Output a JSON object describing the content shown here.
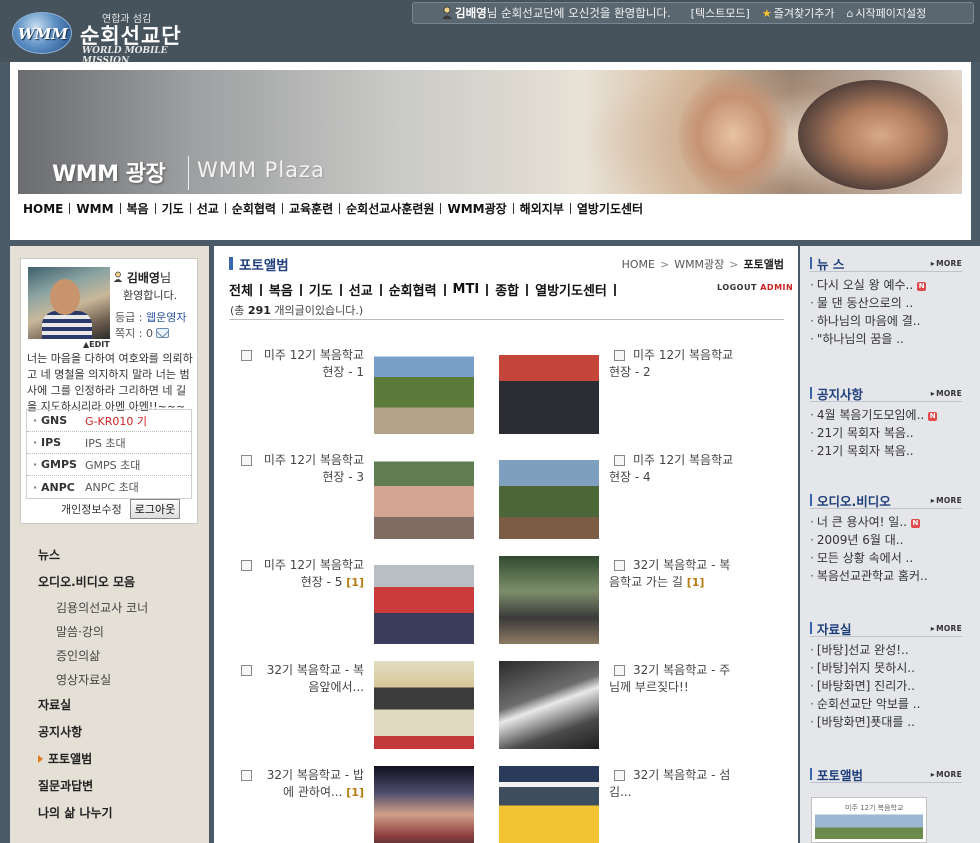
{
  "brand": {
    "tagline": "연합과 섬김",
    "name_kr": "순회선교단",
    "name_en": "WORLD MOBILE MISSION",
    "logo_text": "WMM"
  },
  "welcome": {
    "user": "김배영",
    "message": "님 순회선교단에 오신것을 환영합니다.",
    "text_mode": "[텍스트모드]",
    "bookmark": "즐겨찾기추가",
    "homepage": "시작페이지설정"
  },
  "banner": {
    "title": "WMM 광장",
    "subtitle": "WMM  Plaza"
  },
  "main_nav": [
    {
      "label": "HOME"
    },
    {
      "label": "WMM"
    },
    {
      "label": "복음"
    },
    {
      "label": "기도"
    },
    {
      "label": "선교"
    },
    {
      "label": "순회협력"
    },
    {
      "label": "교육훈련"
    },
    {
      "label": "순회선교사훈련원"
    },
    {
      "label": "WMM광장"
    },
    {
      "label": "해외지부"
    },
    {
      "label": "열방기도센터"
    }
  ],
  "login": {
    "name": "김배영",
    "name_suffix": "님",
    "greet": "환영합니다.",
    "grade_label": "등급 : ",
    "grade_value": "웹운영자",
    "note_label": "쪽지 : 0",
    "edit": "▲EDIT",
    "bio": "너는 마음을 다하여 여호와를 의뢰하고 네 명철을 의지하지 말라 너는 범사에 그를 인정하라 그리하면 네 길을 지도하시리라 아멘 아멘!!~~~",
    "ids": [
      {
        "key": "GNS",
        "value": "G-KR010 기",
        "red": true
      },
      {
        "key": "IPS",
        "value": "IPS 초대",
        "red": false
      },
      {
        "key": "GMPS",
        "value": "GMPS 초대",
        "red": false
      },
      {
        "key": "ANPC",
        "value": "ANPC 초대",
        "red": false
      }
    ],
    "privacy": "개인정보수정",
    "logout": "로그아웃"
  },
  "left_menu": {
    "news": "뉴스",
    "audio_video": "오디오.비디오 모음",
    "sub1": "김용의선교사 코너",
    "sub2": "말씀·강의",
    "sub3": "증인의삶",
    "sub4": "영상자료실",
    "library": "자료실",
    "notice": "공지사항",
    "photo_album": "포토앨범",
    "qna": "질문과답변",
    "share": "나의 삶 나누기"
  },
  "page": {
    "title": "포토앨범",
    "crumb_home": "HOME",
    "crumb_mid": "WMM광장",
    "crumb_cur": "포토앨범",
    "logout_label": "LOGOUT",
    "admin_label": "ADMIN",
    "count_pre": "(총 ",
    "count_num": "291",
    "count_post": " 개의글이있습니다.)"
  },
  "sub_nav": [
    {
      "label": "전체"
    },
    {
      "label": "복음"
    },
    {
      "label": "기도"
    },
    {
      "label": "선교"
    },
    {
      "label": "순회협력"
    },
    {
      "label": "MTI"
    },
    {
      "label": "종합"
    },
    {
      "label": "열방기도센터"
    }
  ],
  "gallery": [
    {
      "title": "미주 12기 복음학교 현장 - 1",
      "count": ""
    },
    {
      "title": "미주 12기 복음학교 현장 - 2",
      "count": ""
    },
    {
      "title": "미주 12기 복음학교 현장 - 3",
      "count": ""
    },
    {
      "title": "미주 12기 복음학교 현장 - 4",
      "count": ""
    },
    {
      "title": "미주 12기 복음학교 현장 - 5",
      "count": "[1]"
    },
    {
      "title": "32기 복음학교 - 복음학교 가는 길",
      "count": "[1]"
    },
    {
      "title": "32기 복음학교 - 복음앞에서...",
      "count": ""
    },
    {
      "title": "32기 복음학교 - 주님께 부르짖다!!",
      "count": ""
    },
    {
      "title": "32기 복음학교 - 밥에 관하여...",
      "count": "[1]"
    },
    {
      "title": "32기 복음학교 - 섬김...",
      "count": ""
    }
  ],
  "right": {
    "news": {
      "title": "뉴 스",
      "more": "MORE",
      "items": [
        "다시 오실 왕 예수..",
        "물 댄 동산으로의 ..",
        "하나님의 마음에 결..",
        "\"하나님의 꿈을 .."
      ]
    },
    "notice": {
      "title": "공지사항",
      "more": "MORE",
      "items": [
        "4월 복음기도모임에..",
        "21기 목회자 복음..",
        "21기 목회자 복음.."
      ]
    },
    "av": {
      "title": "오디오.비디오",
      "more": "MORE",
      "items": [
        "너 큰 용사여! 일..",
        "2009년 6월 대..",
        "모든 상황 속에서 ..",
        "복음선교관학교 홈커.."
      ]
    },
    "library": {
      "title": "자료실",
      "more": "MORE",
      "items": [
        "[바탕]선교 완성!..",
        "[바탕]쉬지 못하시..",
        "[바탕화면] 진리가..",
        "순회선교단 악보를 ..",
        "[바탕화면]푯대를 .."
      ]
    },
    "photo": {
      "title": "포토앨범",
      "more": "MORE",
      "caption": "미주 12기 복음학교"
    }
  },
  "new_badge": "N"
}
